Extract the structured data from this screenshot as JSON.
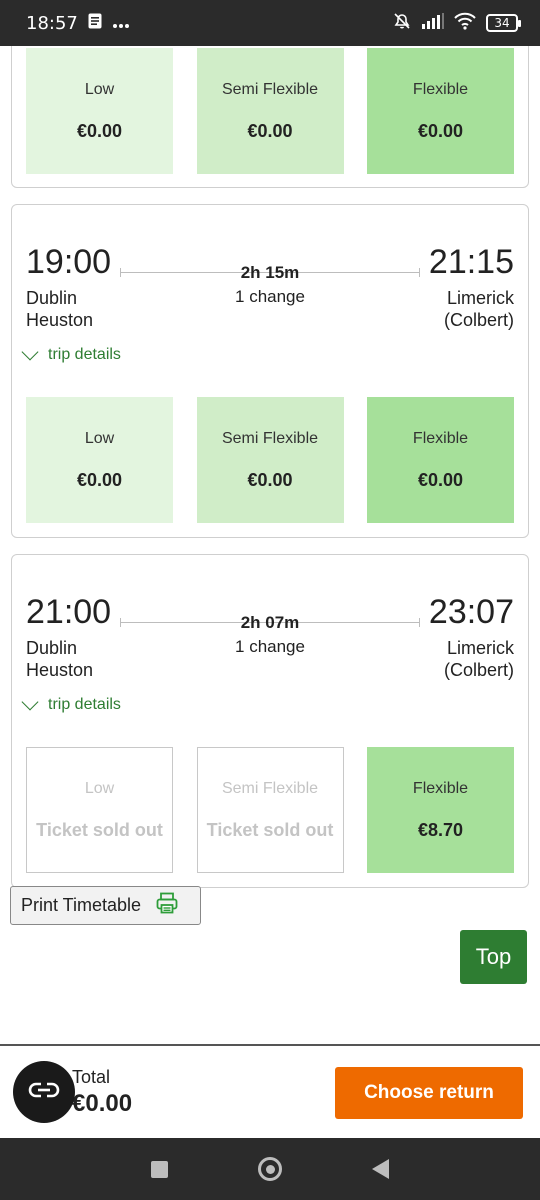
{
  "status_bar": {
    "time": "18:57",
    "battery": "34"
  },
  "cards": [
    {
      "fares": [
        {
          "name": "Low",
          "price": "€0.00"
        },
        {
          "name": "Semi Flexible",
          "price": "€0.00"
        },
        {
          "name": "Flexible",
          "price": "€0.00"
        }
      ]
    },
    {
      "dep_time": "19:00",
      "dep_station_1": "Dublin",
      "dep_station_2": "Heuston",
      "duration": "2h 15m",
      "changes": "1 change",
      "arr_time": "21:15",
      "arr_station_1": "Limerick",
      "arr_station_2": "(Colbert)",
      "trip_details": "trip details",
      "fares": [
        {
          "name": "Low",
          "price": "€0.00"
        },
        {
          "name": "Semi Flexible",
          "price": "€0.00"
        },
        {
          "name": "Flexible",
          "price": "€0.00"
        }
      ]
    },
    {
      "dep_time": "21:00",
      "dep_station_1": "Dublin",
      "dep_station_2": "Heuston",
      "duration": "2h 07m",
      "changes": "1 change",
      "arr_time": "23:07",
      "arr_station_1": "Limerick",
      "arr_station_2": "(Colbert)",
      "trip_details": "trip details",
      "fares": [
        {
          "name": "Low",
          "price": "Ticket sold out"
        },
        {
          "name": "Semi Flexible",
          "price": "Ticket sold out"
        },
        {
          "name": "Flexible",
          "price": "€8.70"
        }
      ]
    }
  ],
  "print_timetable": "Print Timetable",
  "top_button": "Top",
  "total": {
    "label": "Total",
    "value": "€0.00"
  },
  "choose_return": "Choose return",
  "colors": {
    "accent_green": "#2e7d32",
    "orange": "#ee6a00"
  }
}
